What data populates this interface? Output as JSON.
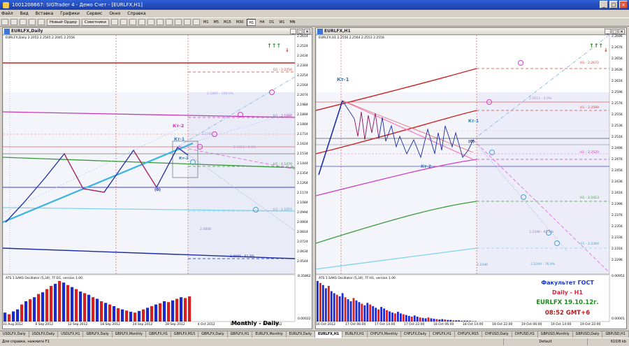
{
  "app": {
    "title": "1001208667: SIGTrader 4 - Демо Счет - [EURLFX,H1]"
  },
  "menu": [
    "Файл",
    "Вид",
    "Вставка",
    "Графики",
    "Сервис",
    "Окно",
    "Справка"
  ],
  "toolbar": {
    "new_order": "Новый Ордер",
    "advisors": "Советники",
    "timeframes": [
      "M1",
      "M5",
      "M15",
      "M30",
      "H1",
      "H4",
      "D1",
      "W1",
      "MN"
    ],
    "active_tf": "H1"
  },
  "left_chart": {
    "title": "EURLFX,Daily",
    "info": "EURLFX,Daily  2.2052 2.2565 2.2045 2.2556",
    "oscillator_label": "ATS 1.SAKS Oscillator (5,34), TF:D1, version 1.00",
    "osc_scale_top": "0.35862",
    "osc_scale_bottom": "0.00022",
    "prices": [
      "2.2614",
      "2.2524",
      "2.2434",
      "2.2344",
      "2.2254",
      "2.2164",
      "2.2074",
      "2.1984",
      "2.1894",
      "2.1804",
      "2.1714",
      "2.1624",
      "2.1534",
      "2.1444",
      "2.1354",
      "2.1264",
      "2.1174",
      "2.1084",
      "2.0994",
      "2.0904",
      "2.0814",
      "2.0724",
      "2.0634",
      "2.0544"
    ],
    "highlight_prices": [
      "2.1654",
      "2.1673",
      "2.1637",
      "2.1474",
      "2.1314"
    ],
    "dates": [
      "31 Aug 2012",
      "6 Sep 2012",
      "12 Sep 2012",
      "18 Sep 2012",
      "24 Sep 2012",
      "28 Sep 2012",
      "4 Oct 2012",
      "10 Oct 2012",
      "16 Oct 2012"
    ],
    "labels": {
      "kt1": "Кт-1",
      "kt2": "Кт-2",
      "kt2b": "Кт-2",
      "zero": "(0)",
      "d1_a": "D1 - 2.2256",
      "d1_b": "H1 - 2.1886",
      "d1_c": "H1 - 2.1470",
      "d1_d": "H1 - 2.1055",
      "d1_e": "2.0666 - 61.8%",
      "pct_a": "2.1880 - 100.0%",
      "pct_b": "2.1613 - 0.0%",
      "pct_c": "2.0808",
      "pct_d": "2.1768",
      "monthly_daily": "Monthly - Daily"
    },
    "hist": [
      0.22,
      0.18,
      0.25,
      0.3,
      0.42,
      0.5,
      0.55,
      0.6,
      0.68,
      0.72,
      0.8,
      0.88,
      0.93,
      1.0,
      0.96,
      0.9,
      0.85,
      0.8,
      0.74,
      0.7,
      0.66,
      0.6,
      0.56,
      0.5,
      0.46,
      0.42,
      0.38,
      0.33,
      0.3,
      0.27,
      0.24,
      0.22,
      0.26,
      0.3,
      0.34,
      0.38,
      0.42,
      0.45,
      0.5,
      0.48,
      0.52,
      0.56,
      0.6,
      0.58,
      0.62
    ],
    "hist_colors": [
      "b",
      "r",
      "b",
      "b",
      "r",
      "b",
      "r",
      "b",
      "r",
      "b",
      "r",
      "r",
      "b",
      "r",
      "b",
      "r",
      "b",
      "r",
      "b",
      "r",
      "b",
      "r",
      "b",
      "r",
      "b",
      "r",
      "b",
      "r",
      "b",
      "r",
      "b",
      "r",
      "b",
      "r",
      "b",
      "r",
      "b",
      "r",
      "b",
      "r",
      "b",
      "r",
      "b",
      "r",
      "r"
    ]
  },
  "right_chart": {
    "title": "EURLFX,H1",
    "info": "EURLFX,H1  2.2556 2.2564 2.2553 2.2556",
    "oscillator_label": "ATS 1.SAKS Oscillator (5,34), TF:H1, version 1.00",
    "osc_scale_top": "0.00952",
    "osc_scale_bottom": "0.00001",
    "prices": [
      "2.2696",
      "2.2676",
      "2.2656",
      "2.2636",
      "2.2616",
      "2.2596",
      "2.2576",
      "2.2556",
      "2.2536",
      "2.2516",
      "2.2496",
      "2.2476",
      "2.2456",
      "2.2436",
      "2.2416",
      "2.2396",
      "2.2376",
      "2.2356",
      "2.2336",
      "2.2316",
      "2.2296"
    ],
    "highlight_prices": [
      "2.2611",
      "2.2556",
      "2.2540"
    ],
    "dates": [
      "16 Oct 2012",
      "17 Oct 06:00",
      "17 Oct 14:00",
      "17 Oct 22:00",
      "18 Oct 06:00",
      "18 Oct 14:00",
      "18 Oct 22:00",
      "19 Oct 06:00",
      "19 Oct 14:00",
      "19 Oct 22:00"
    ],
    "labels": {
      "kt1a": "Кт-1",
      "kt1b": "Кт-1",
      "kt2": "Кт-2",
      "zero": "(0)",
      "h1_a": "H1 - 2.2672",
      "h1_b": "H1 - 2.2599",
      "h1_c": "H1 - 2.2520",
      "h1_d": "H1 - 2.2413",
      "h1_e": "2.2346 - 61.8%",
      "h1_f": "H1 - 2.2394",
      "pct_a": "2.2612 - 0.0%",
      "pct_b": "2.2346",
      "pct_c": "2.2344 - 76.4%"
    },
    "legend": {
      "line1": "Факультет ГОСТ",
      "line2": "Daily - H1",
      "line3": "EURLFX 19.10.12г.",
      "line4": "08:52 GMT+6"
    },
    "hist": [
      1.0,
      0.95,
      0.9,
      0.82,
      0.88,
      0.75,
      0.7,
      0.66,
      0.62,
      0.7,
      0.6,
      0.55,
      0.5,
      0.58,
      0.52,
      0.48,
      0.44,
      0.4,
      0.46,
      0.42,
      0.38,
      0.34,
      0.3,
      0.36,
      0.32,
      0.28,
      0.25,
      0.22,
      0.2,
      0.24,
      0.2,
      0.18,
      0.16,
      0.14,
      0.12,
      0.15,
      0.12,
      0.1,
      0.09,
      0.08,
      0.1,
      0.08,
      0.07,
      0.06,
      0.05,
      0.06,
      0.05,
      0.04,
      0.04,
      0.03,
      0.03,
      0.03,
      0.02,
      0.02,
      0.02,
      0.02,
      0.01,
      0.01
    ]
  },
  "tabs": [
    "USDLFX,Daily",
    "USDLFX,Daily",
    "USDLFX,H1",
    "GBPLFX,Daily",
    "GBPLFX,Monthly",
    "GBPLFX,H1",
    "GBPLFX,M15",
    "GBPLFX,Daily",
    "GBPLFX,H1",
    "EURLFX,Monthly",
    "EURLFX,Daily",
    "EURLFX,H1",
    "CHFLFX,Monthly",
    "CHFLFX,Daily",
    "CHFLFX,H1",
    "CHFLFX,M15",
    "CHFUSD,Daily",
    "CHFUSD,H1",
    "GBPUSD,Monthly",
    "GBPUSD,Daily",
    "GBPUSD,H1",
    "GBPUSD,M15",
    "GBPUSD,Daily"
  ],
  "active_tab": "EURLFX,H1",
  "status": {
    "left": "Для справки, нажмите F1",
    "mid": "Default",
    "right": "610/8 kb"
  }
}
